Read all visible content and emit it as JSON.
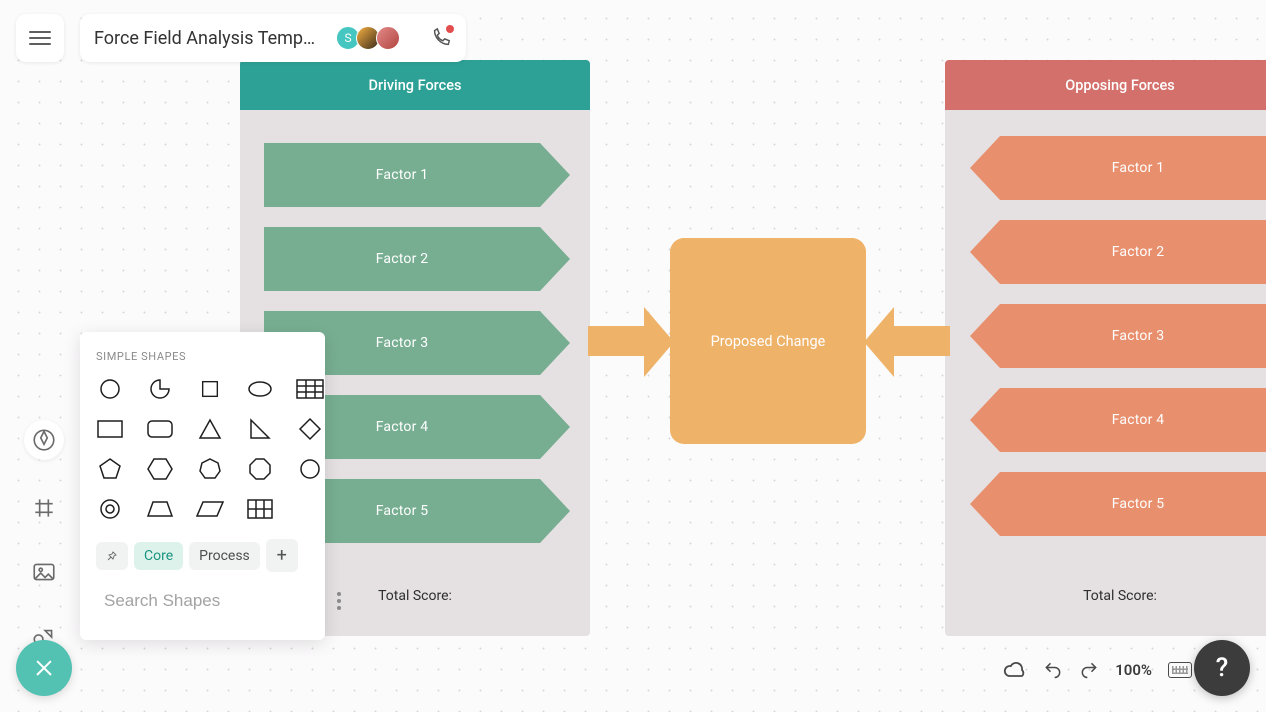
{
  "doc_title": "Force Field Analysis Templ...",
  "avatars": {
    "initial": "S"
  },
  "shapes_panel": {
    "header": "SIMPLE SHAPES",
    "tabs": {
      "core": "Core",
      "process": "Process"
    },
    "search_placeholder": "Search Shapes"
  },
  "driving": {
    "title": "Driving Forces",
    "factors": [
      "Factor   1",
      "Factor   2",
      "Factor   3",
      "Factor   4",
      "Factor   5"
    ],
    "total": "Total Score:"
  },
  "opposing": {
    "title": "Opposing Forces",
    "factors": [
      "Factor   1",
      "Factor   2",
      "Factor   3",
      "Factor   4",
      "Factor   5"
    ],
    "total": "Total Score:"
  },
  "center_label": "Proposed Change",
  "status": {
    "zoom": "100%",
    "help": "?"
  }
}
